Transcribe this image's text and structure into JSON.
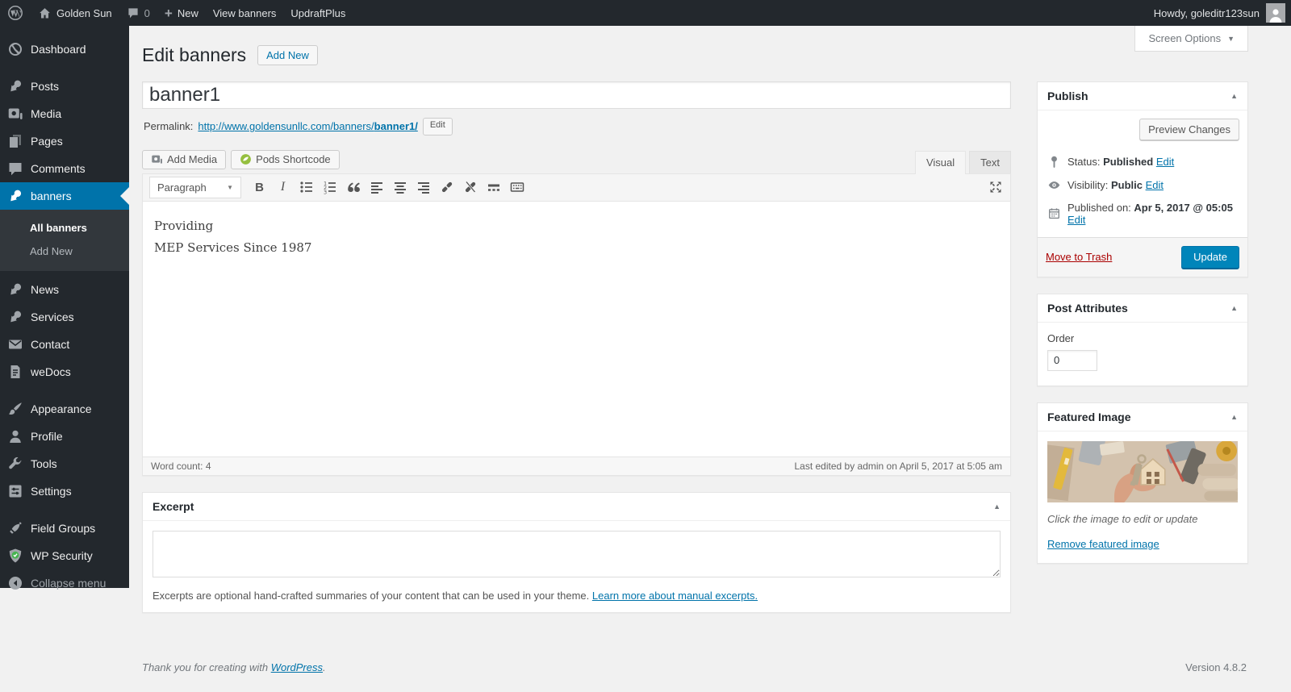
{
  "admin_bar": {
    "site_name": "Golden Sun",
    "comment_count": "0",
    "new_label": "New",
    "view_banners_label": "View banners",
    "updraft_label": "UpdraftPlus",
    "howdy": "Howdy, goleditr123sun"
  },
  "screen_options": {
    "label": "Screen Options"
  },
  "icons": {
    "chevron_down": "▼",
    "panel_toggle_up": "▲",
    "plus": "+",
    "select_caret": "▼"
  },
  "sidebar": {
    "items": [
      {
        "label": "Dashboard"
      },
      {
        "label": "Posts"
      },
      {
        "label": "Media"
      },
      {
        "label": "Pages"
      },
      {
        "label": "Comments"
      },
      {
        "label": "banners"
      },
      {
        "label": "News"
      },
      {
        "label": "Services"
      },
      {
        "label": "Contact"
      },
      {
        "label": "weDocs"
      },
      {
        "label": "Appearance"
      },
      {
        "label": "Profile"
      },
      {
        "label": "Tools"
      },
      {
        "label": "Settings"
      },
      {
        "label": "Field Groups"
      },
      {
        "label": "WP Security"
      },
      {
        "label": "Collapse menu"
      }
    ],
    "submenu": [
      {
        "label": "All banners"
      },
      {
        "label": "Add New"
      }
    ]
  },
  "page": {
    "title": "Edit banners",
    "add_new_label": "Add New",
    "post_title": "banner1",
    "permalink_label": "Permalink:",
    "permalink_base": "http://www.goldensunllc.com/banners/",
    "permalink_slug": "banner1/",
    "edit_button": "Edit"
  },
  "editor": {
    "add_media_label": "Add Media",
    "pods_shortcode_label": "Pods Shortcode",
    "tab_visual": "Visual",
    "tab_text": "Text",
    "format_select": "Paragraph",
    "content_line1": "Providing",
    "content_line2": "MEP Services Since 1987",
    "word_count_label": "Word count:",
    "word_count": "4",
    "last_edited": "Last edited by admin on April 5, 2017 at 5:05 am"
  },
  "excerpt": {
    "title": "Excerpt",
    "value": "",
    "help_text": "Excerpts are optional hand-crafted summaries of your content that can be used in your theme.",
    "help_link": "Learn more about manual excerpts."
  },
  "publish": {
    "title": "Publish",
    "preview_changes_label": "Preview Changes",
    "status_label": "Status:",
    "status_value": "Published",
    "visibility_label": "Visibility:",
    "visibility_value": "Public",
    "published_label": "Published on:",
    "published_value": "Apr 5, 2017 @ 05:05",
    "edit_link": "Edit",
    "move_to_trash_label": "Move to Trash",
    "update_label": "Update"
  },
  "post_attributes": {
    "title": "Post Attributes",
    "order_label": "Order",
    "order_value": "0"
  },
  "featured_image": {
    "title": "Featured Image",
    "caption": "Click the image to edit or update",
    "remove_link": "Remove featured image"
  },
  "footer": {
    "thanks_text": "Thank you for creating with",
    "wordpress_link": "WordPress",
    "period": ".",
    "version": "Version 4.8.2"
  },
  "colors": {
    "accent": "#0073aa",
    "primary_button": "#0085ba",
    "admin_dark": "#23282d",
    "trash_red": "#a00"
  }
}
